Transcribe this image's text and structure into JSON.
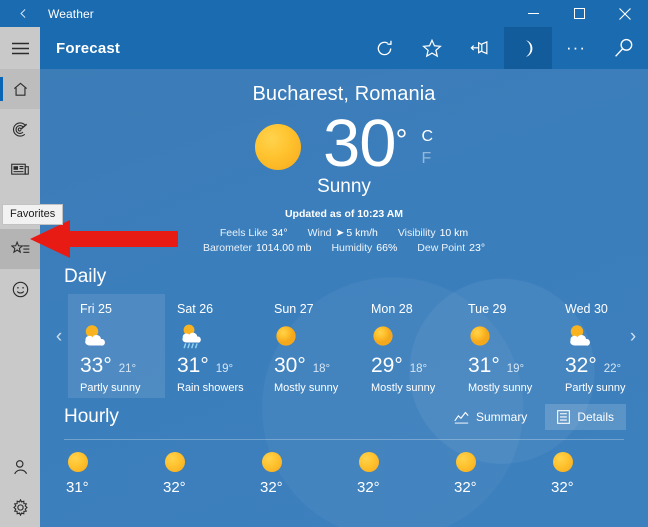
{
  "titlebar": {
    "back_icon": "back-arrow-icon",
    "title": "Weather",
    "minimize_label": "minimize-icon",
    "maximize_label": "maximize-icon",
    "close_label": "close-icon"
  },
  "header": {
    "title": "Forecast",
    "buttons": [
      {
        "name": "refresh-icon"
      },
      {
        "name": "favorite-star-icon"
      },
      {
        "name": "pin-icon"
      },
      {
        "name": "night-mode-moon-icon"
      },
      {
        "name": "more-options-icon",
        "label": "···"
      },
      {
        "name": "search-icon"
      }
    ]
  },
  "sidebar": {
    "items": [
      {
        "name": "hamburger-menu",
        "icon": "hamburger-icon"
      },
      {
        "name": "forecast-home",
        "icon": "home-icon"
      },
      {
        "name": "maps",
        "icon": "radar-icon"
      },
      {
        "name": "news",
        "icon": "news-icon"
      },
      {
        "name": "historical-weather",
        "icon": "wave-chart-icon"
      },
      {
        "name": "favorites",
        "icon": "favorites-star-list-icon"
      },
      {
        "name": "send-feedback",
        "icon": "smiley-face-icon"
      }
    ],
    "bottom_items": [
      {
        "name": "account",
        "icon": "person-icon"
      },
      {
        "name": "settings",
        "icon": "gear-icon"
      }
    ],
    "tooltip": "Favorites"
  },
  "current": {
    "location": "Bucharest, Romania",
    "icon": "sun-icon",
    "temperature": "30",
    "degree": "°",
    "unit_celsius": "C",
    "unit_fahrenheit": "F",
    "condition": "Sunny",
    "updated": "Updated as of 10:23 AM",
    "details_row1": [
      {
        "label": "Feels Like",
        "value": "34°"
      },
      {
        "label": "Wind",
        "value": "5 km/h",
        "icon": "wind-direction-arrow"
      },
      {
        "label": "Visibility",
        "value": "10 km"
      }
    ],
    "details_row2": [
      {
        "label": "Barometer",
        "value": "1014.00 mb"
      },
      {
        "label": "Humidity",
        "value": "66%"
      },
      {
        "label": "Dew Point",
        "value": "23°"
      }
    ]
  },
  "daily": {
    "title": "Daily",
    "prev_label": "‹",
    "next_label": "›",
    "days": [
      {
        "day": "Fri 25",
        "icon": "partly-sunny-icon",
        "high": "33°",
        "low": "21°",
        "desc": "Partly sunny",
        "selected": true
      },
      {
        "day": "Sat 26",
        "icon": "rain-showers-icon",
        "high": "31°",
        "low": "19°",
        "desc": "Rain showers",
        "selected": false
      },
      {
        "day": "Sun 27",
        "icon": "sunny-icon",
        "high": "30°",
        "low": "18°",
        "desc": "Mostly sunny",
        "selected": false
      },
      {
        "day": "Mon 28",
        "icon": "sunny-icon",
        "high": "29°",
        "low": "18°",
        "desc": "Mostly sunny",
        "selected": false
      },
      {
        "day": "Tue 29",
        "icon": "sunny-icon",
        "high": "31°",
        "low": "19°",
        "desc": "Mostly sunny",
        "selected": false
      },
      {
        "day": "Wed 30",
        "icon": "partly-sunny-icon",
        "high": "32°",
        "low": "22°",
        "desc": "Partly sunny",
        "selected": false
      }
    ]
  },
  "hourly": {
    "title": "Hourly",
    "summary_label": "Summary",
    "details_label": "Details",
    "summary_icon": "line-chart-icon",
    "details_icon": "list-details-icon",
    "hours": [
      {
        "icon": "sunny-icon",
        "temp": "31°"
      },
      {
        "icon": "sunny-icon",
        "temp": "32°"
      },
      {
        "icon": "sunny-icon",
        "temp": "32°"
      },
      {
        "icon": "sunny-icon",
        "temp": "32°"
      },
      {
        "icon": "sunny-icon",
        "temp": "32°"
      },
      {
        "icon": "sunny-icon",
        "temp": "32°"
      }
    ]
  },
  "colors": {
    "chrome_blue": "#1a6bb0",
    "content_blue": "#3c7cb7",
    "rail_gray": "#c9c9c9",
    "sun_yellow": "#ffc22e",
    "annotation_red": "#e81b14"
  }
}
